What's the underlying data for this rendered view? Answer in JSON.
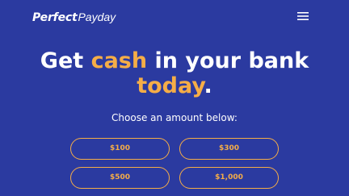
{
  "header": {
    "logo_strong": "Perfect",
    "logo_light": "Payday",
    "menu_icon": "hamburger-menu-icon"
  },
  "hero": {
    "part1": "Get ",
    "accent1": "cash",
    "part2": " in your bank ",
    "accent2": "today",
    "part3": "."
  },
  "subtitle": "Choose an amount below:",
  "amounts": [
    "$100",
    "$300",
    "$500",
    "$1,000"
  ],
  "colors": {
    "background": "#2b3aa0",
    "accent": "#f5ad47",
    "text": "#ffffff"
  }
}
